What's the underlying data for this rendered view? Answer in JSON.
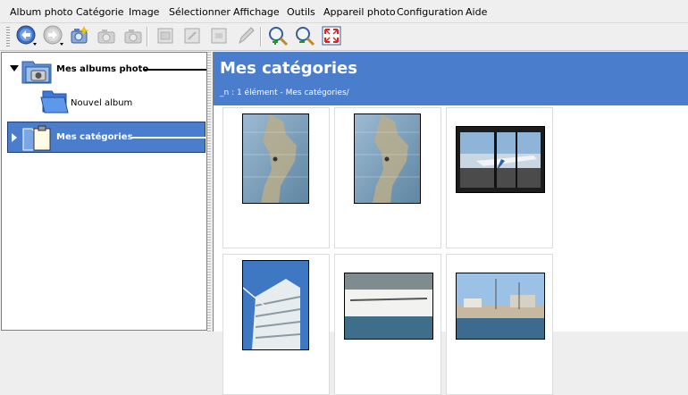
{
  "menubar": {
    "items": [
      {
        "label": "Album photo",
        "id": "album-photo"
      },
      {
        "label": "Catégorie",
        "id": "categorie"
      },
      {
        "label": "Image",
        "id": "image"
      },
      {
        "label": "Sélectionner",
        "id": "selectionner"
      },
      {
        "label": "Affichage",
        "id": "affichage"
      },
      {
        "label": "Outils",
        "id": "outils"
      },
      {
        "label": "Appareil photo",
        "id": "appareil-photo"
      },
      {
        "label": "Configuration",
        "id": "configuration"
      },
      {
        "label": "Aide",
        "id": "aide"
      }
    ]
  },
  "toolbar": {
    "buttons": [
      {
        "icon": "back-arrow-icon",
        "enabled": true
      },
      {
        "icon": "forward-arrow-icon",
        "enabled": false
      },
      {
        "icon": "add-photos-icon",
        "enabled": true
      },
      {
        "icon": "camera-icon",
        "enabled": false
      },
      {
        "icon": "camera-icon",
        "enabled": false
      },
      {
        "icon": "image-properties-icon",
        "enabled": false
      },
      {
        "icon": "image-edit-icon",
        "enabled": false
      },
      {
        "icon": "image-comment-icon",
        "enabled": false
      },
      {
        "icon": "pencil-icon",
        "enabled": false
      },
      {
        "icon": "zoom-in-icon",
        "enabled": true
      },
      {
        "icon": "zoom-out-icon",
        "enabled": true
      },
      {
        "icon": "fullscreen-icon",
        "enabled": true
      }
    ]
  },
  "tree": {
    "items": [
      {
        "label": "Mes albums photo",
        "bold": true,
        "expanded": true,
        "selected": false,
        "icon": "photo-albums-icon"
      },
      {
        "label": "Nouvel album",
        "bold": false,
        "selected": false,
        "icon": "blue-folder-icon"
      },
      {
        "label": "Mes catégories",
        "bold": true,
        "expanded": false,
        "selected": true,
        "icon": "categories-icon"
      }
    ]
  },
  "content": {
    "title": "Mes catégories",
    "path": "_n : 1 élément - Mes catégories/",
    "thumbnails": [
      {
        "subject": "map"
      },
      {
        "subject": "map"
      },
      {
        "subject": "airplane"
      },
      {
        "subject": "building"
      },
      {
        "subject": "boat"
      },
      {
        "subject": "harbor"
      }
    ]
  },
  "colors": {
    "selection": "#4a7dcc",
    "header": "#4a7dcc",
    "background": "#eeeeee"
  }
}
